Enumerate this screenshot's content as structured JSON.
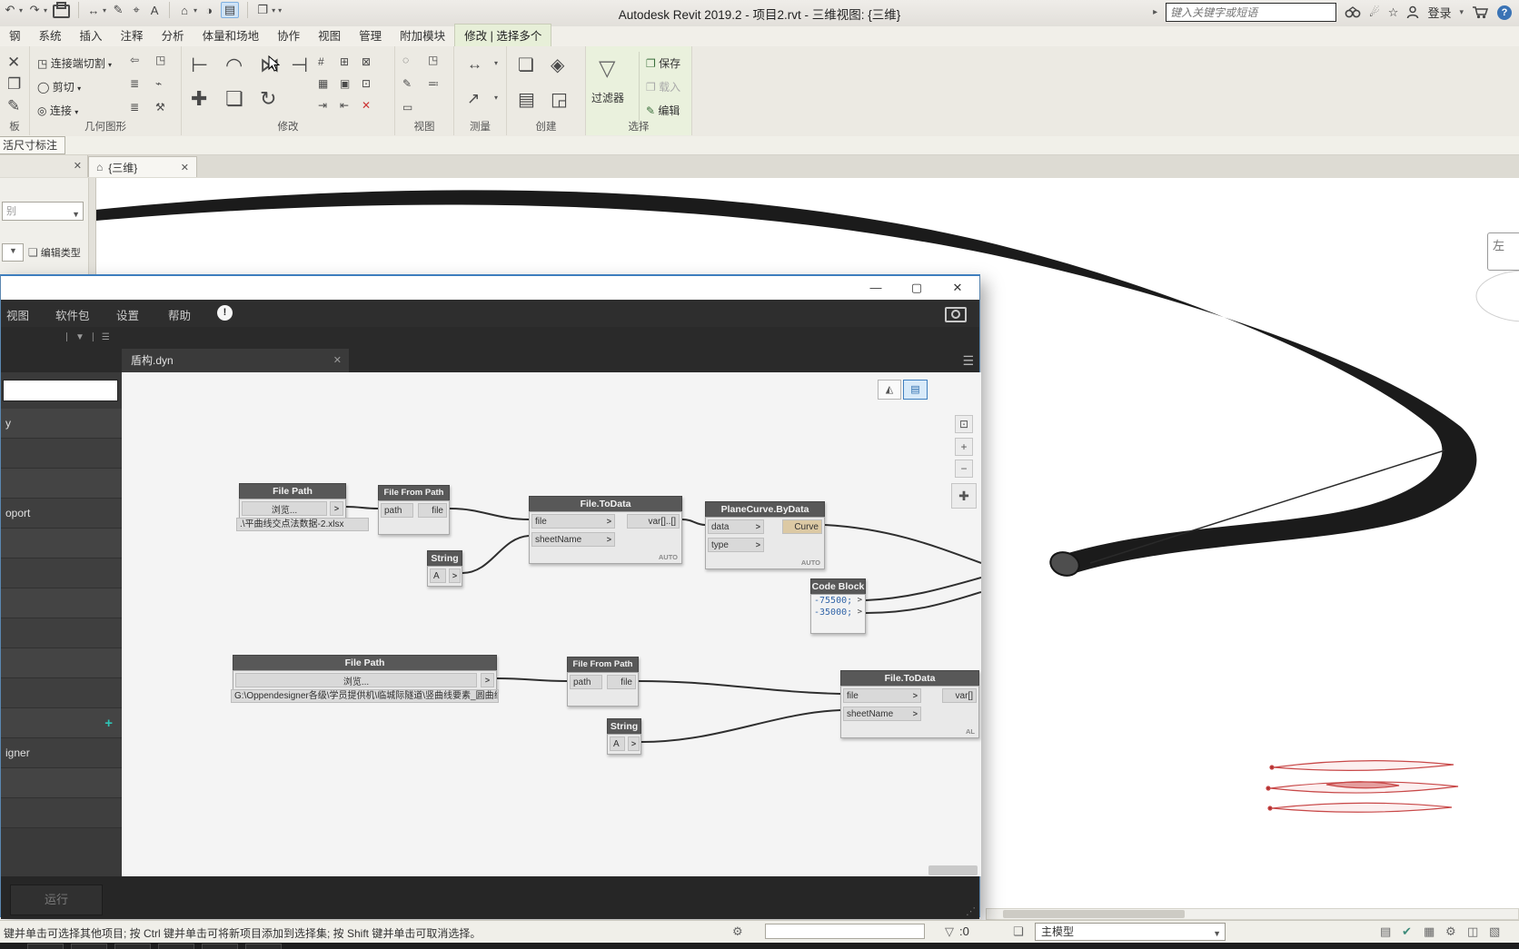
{
  "revit": {
    "title": "Autodesk Revit 2019.2 - 项目2.rvt - 三维视图: {三维}",
    "search_placeholder": "键入关键字或短语",
    "signin": "登录",
    "tabs": [
      "钢",
      "系统",
      "插入",
      "注释",
      "分析",
      "体量和场地",
      "协作",
      "视图",
      "管理",
      "附加模块"
    ],
    "active_tab": "修改 | 选择多个",
    "ribbon": {
      "clipboard_label": "板",
      "geometry_label": "几何图形",
      "geometry_b1": "连接端切割",
      "geometry_b2": "剪切",
      "geometry_b3": "连接",
      "modify_label": "修改",
      "view_label": "视图",
      "measure_label": "测量",
      "create_label": "创建",
      "select_label": "选择",
      "filter": "过滤器",
      "save": "保存",
      "load": "载入",
      "edit": "编辑"
    },
    "options_bar": "活尺寸标注",
    "view_tab": "{三维}",
    "props": {
      "category": "别",
      "edit_type": "编辑类型"
    },
    "edge_label": "左",
    "status": {
      "hint": "键并单击可选择其他项目; 按 Ctrl 键并单击可将新项目添加到选择集; 按 Shift 键并单击可取消选择。",
      "filter_count": ":0",
      "model": "主模型"
    }
  },
  "dynamo": {
    "menus": [
      "视图",
      "软件包",
      "设置",
      "帮助"
    ],
    "tab": "盾构.dyn",
    "run": "运行",
    "library": {
      "item1": "y",
      "item2": "oport",
      "item3": "igner"
    },
    "nodes": {
      "filePath1": {
        "title": "File Path",
        "browse": "浏览...",
        "caption": ".\\平曲线交点法数据-2.xlsx"
      },
      "fromPath1": {
        "title": "File From Path",
        "in": "path",
        "out": "file"
      },
      "string1": {
        "title": "String",
        "in": "A"
      },
      "toData1": {
        "title": "File.ToData",
        "in1": "file",
        "in2": "sheetName",
        "out": "var[]..[]",
        "auto": "AUTO"
      },
      "planeCurve": {
        "title": "PlaneCurve.ByData",
        "in1": "data",
        "in2": "type",
        "out": "Curve",
        "auto": "AUTO"
      },
      "codeBlock": {
        "title": "Code Block",
        "line1": "-75500;",
        "line2": "-35000;"
      },
      "filePath2": {
        "title": "File Path",
        "browse": "浏览...",
        "caption": "G:\\Oppendesigner各级\\学员提供机\\临城际隧道\\竖曲线要素_圆曲线.xlsx"
      },
      "fromPath2": {
        "title": "File From Path",
        "in": "path",
        "out": "file"
      },
      "string2": {
        "title": "String",
        "in": "A"
      },
      "toData2": {
        "title": "File.ToData",
        "in1": "file",
        "in2": "sheetName",
        "out": "var[]",
        "auto": "AL"
      }
    }
  },
  "icons": {
    "undo": "↶",
    "redo": "↷",
    "dropdown": "▾",
    "measure": "↔",
    "pencil": "✎",
    "tag": "⌖",
    "text": "A",
    "home": "⌂",
    "section": "◑",
    "thin_lines": "▤",
    "windows": "❐",
    "search_arrow": "▸",
    "star": "☆",
    "comm": "☄",
    "help": "?",
    "close": "✕",
    "min": "—",
    "max": "▢",
    "clip1": "✕",
    "clip2": "❐",
    "clip3": "✎",
    "geo_cut": "◯",
    "geo_join": "◎",
    "geo_r1": "⇦",
    "geo_r2": "◳",
    "geo_r3": "≣",
    "geo_r4": "⚒",
    "geo_r5": "⌁",
    "mod_b1": "⊢",
    "mod_b2": "◠",
    "mod_b3": "⋈",
    "mod_b4": "⊣",
    "mod_b5": "✚",
    "mod_b6": "❏",
    "mod_b7": "↻",
    "mod_b8": "⇌",
    "mod_s1": "#",
    "mod_s2": "⊞",
    "mod_s3": "⊠",
    "mod_s4": "▦",
    "mod_s5": "▣",
    "mod_s6": "⊡",
    "mod_s7": "⇥",
    "mod_s8": "⇤",
    "mod_s9": "✕",
    "view_1": "◌",
    "view_2": "◳",
    "view_3": "✎",
    "view_4": "≕",
    "view_5": "▭",
    "measure_1": "↔",
    "measure_2": "↗",
    "create_1": "❏",
    "create_2": "◈",
    "create_3": "▤",
    "create_4": "◲",
    "filter": "▽",
    "sel_save": "❐",
    "sel_load": "❐",
    "sel_edit": "✎",
    "alert": "!",
    "lib_1": "∣",
    "lib_2": "▼",
    "lib_3": "∣",
    "lib_4": "☰",
    "hamburger": "☰",
    "tab_close": "✕",
    "cv_b1": "◭",
    "cv_b2": "▤",
    "fit": "⊡",
    "plus": "+",
    "minus": "−",
    "pan": "✚",
    "grip": "⋰",
    "status_gear": "⚙",
    "status_funnel": "▽",
    "status_box": "❏",
    "caret": "▼",
    "sr1": "▤",
    "sr2": "✔",
    "sr3": "▦",
    "sr4": "⚙",
    "sr5": "◫",
    "sr6": "▧"
  }
}
